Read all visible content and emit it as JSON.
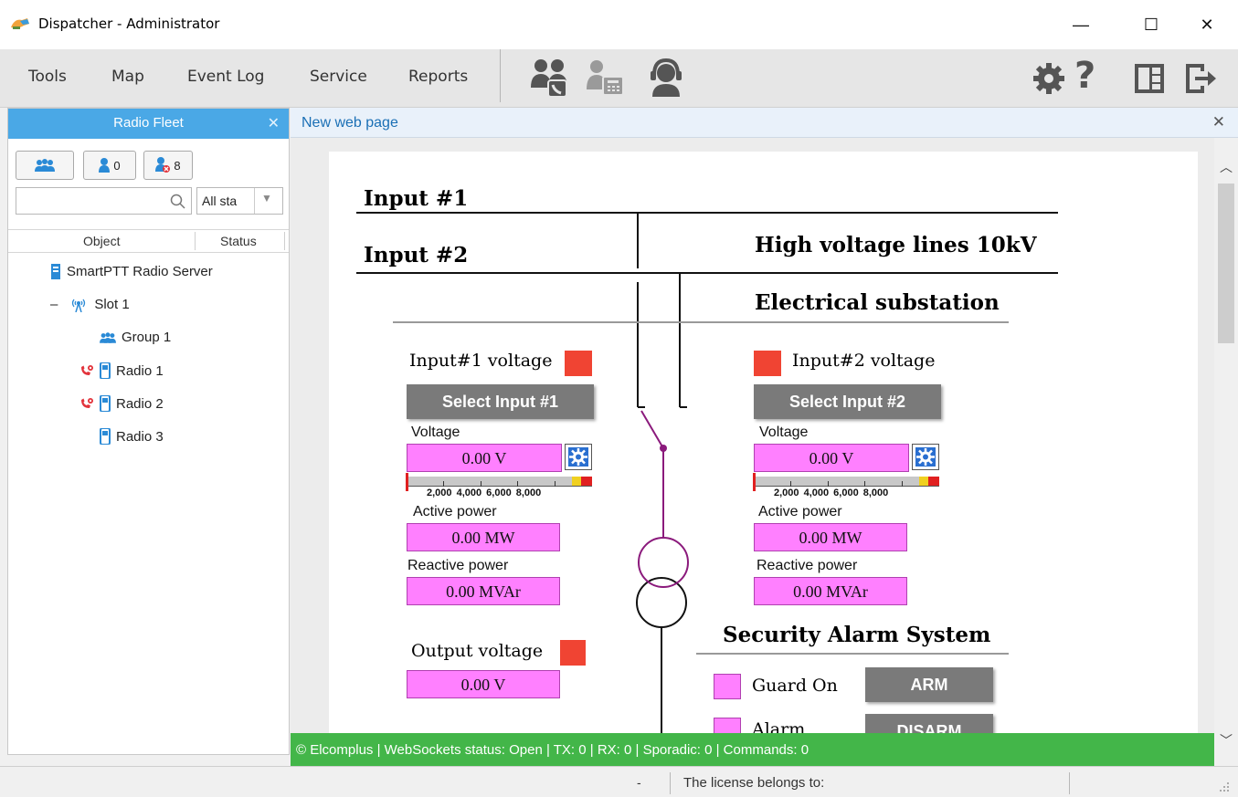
{
  "window": {
    "title": "Dispatcher - Administrator",
    "controls": {
      "minimize": "—",
      "maximize": "☐",
      "close": "✕"
    }
  },
  "menu": {
    "items": [
      "Tools",
      "Map",
      "Event Log",
      "Service",
      "Reports"
    ],
    "toolbar_icons": [
      "call-group-icon",
      "telephone-icon",
      "headset-operator-icon"
    ],
    "right_icons": [
      "gear-icon",
      "help-icon",
      "layout-icon",
      "logout-icon"
    ]
  },
  "radio_fleet": {
    "title": "Radio Fleet",
    "close": "✕",
    "buttons": [
      {
        "icon": "group-icon",
        "label": ""
      },
      {
        "icon": "user-icon",
        "label": "0"
      },
      {
        "icon": "user-offline-icon",
        "label": "8"
      }
    ],
    "search_placeholder": "",
    "status_filter": "All sta",
    "columns": [
      "Object",
      "Status"
    ],
    "tree": [
      {
        "label": "SmartPTT Radio Server",
        "icon": "server-icon",
        "indent": 0
      },
      {
        "label": "Slot 1",
        "icon": "antenna-icon",
        "indent": 1,
        "expander": "–"
      },
      {
        "label": "Group 1",
        "icon": "group-icon",
        "indent": 2
      },
      {
        "label": "Radio 1",
        "icon": "radio-icon",
        "indent": 2,
        "status": "call-red-icon"
      },
      {
        "label": "Radio 2",
        "icon": "radio-icon",
        "indent": 2,
        "status": "call-red-icon"
      },
      {
        "label": "Radio 3",
        "icon": "radio-icon",
        "indent": 2
      }
    ]
  },
  "tab": {
    "title": "New web page",
    "close": "✕"
  },
  "web": {
    "input1": "Input #1",
    "input2": "Input #2",
    "hv_lines": "High voltage lines 10kV",
    "substation": "Electrical substation",
    "left": {
      "voltage_title": "Input#1 voltage",
      "select_btn": "Select Input #1",
      "voltage_label": "Voltage",
      "voltage_value": "0.00 V",
      "gauge_ticks": "2,000 4,000 6,000 8,000",
      "active_label": "Active power",
      "active_value": "0.00 MW",
      "reactive_label": "Reactive power",
      "reactive_value": "0.00 MVAr"
    },
    "right": {
      "voltage_title": "Input#2 voltage",
      "select_btn": "Select Input #2",
      "voltage_label": "Voltage",
      "voltage_value": "0.00 V",
      "gauge_ticks": "2,000 4,000 6,000 8,000",
      "active_label": "Active power",
      "active_value": "0.00 MW",
      "reactive_label": "Reactive power",
      "reactive_value": "0.00 MVAr"
    },
    "output_voltage_title": "Output voltage",
    "output_voltage_value": "0.00 V",
    "security_title": "Security Alarm System",
    "guard_on": "Guard On",
    "arm_btn": "ARM",
    "alarm": "Alarm",
    "disarm_btn": "DISARM"
  },
  "green_status": "© Elcomplus | WebSockets status: Open | TX: 0 | RX: 0 | Sporadic: 0 | Commands: 0",
  "statusbar": {
    "dash": "-",
    "license": "The license belongs to:"
  },
  "colors": {
    "accent": "#4aa8e6",
    "green": "#43b649",
    "pink": "#ff80ff",
    "red": "#f04433",
    "purple": "#8b1a7c"
  }
}
